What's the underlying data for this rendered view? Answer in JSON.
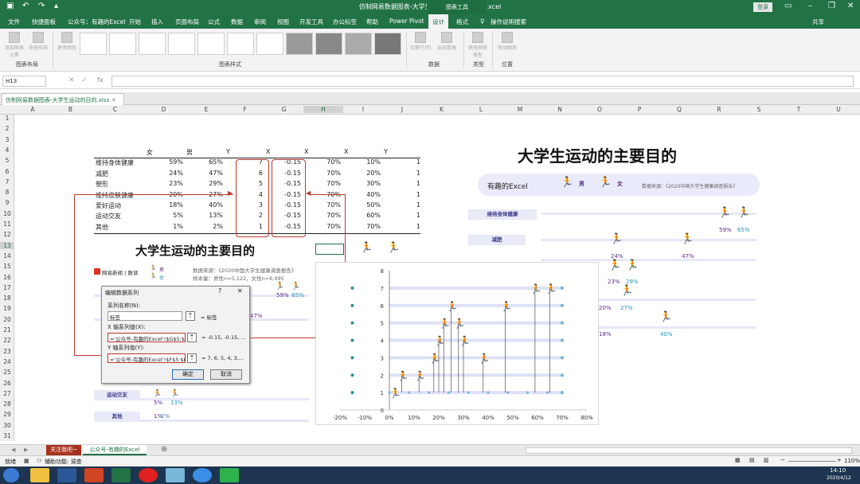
{
  "titlebar": {
    "title": "仿制网易数据图表-大学生运动的目的.xlsx  -  Excel",
    "chart_tools": "图表工具",
    "login": "登录"
  },
  "menu": [
    "文件",
    "快捷面板",
    "公众号：有趣的Excel",
    "开始",
    "插入",
    "页面布局",
    "公式",
    "数据",
    "审阅",
    "视图",
    "开发工具",
    "办公标签",
    "帮助",
    "Power Pivot",
    "设计",
    "格式",
    "操作说明搜索"
  ],
  "menu_selected": "设计",
  "share": "共享",
  "ribbon": {
    "groups": [
      "图表布局",
      "图表样式",
      "数据",
      "类型",
      "位置"
    ],
    "buttons": [
      "添加图表元素",
      "快速布局",
      "更改颜色",
      "切换行/列",
      "选择数据",
      "更改图表类型",
      "移动图表"
    ]
  },
  "formula_bar": {
    "name_box": "H13",
    "fx": "fx",
    "value": ""
  },
  "workbook_tab": "仿制网易数据图表-大学生运动的目的.xlsx",
  "columns": [
    "A",
    "B",
    "C",
    "D",
    "E",
    "F",
    "G",
    "H",
    "I",
    "J",
    "K",
    "L",
    "M",
    "N",
    "O",
    "P",
    "Q",
    "R",
    "S",
    "T",
    "U"
  ],
  "rows": [
    "1",
    "2",
    "3",
    "4",
    "5",
    "6",
    "7",
    "8",
    "9",
    "10",
    "11",
    "12",
    "13",
    "14",
    "15",
    "16",
    "17",
    "18",
    "19",
    "20",
    "21",
    "22",
    "23",
    "24",
    "25",
    "26",
    "27",
    "28",
    "29",
    "30",
    "31"
  ],
  "table": {
    "headers": [
      "女",
      "男",
      "Y",
      "X",
      "X",
      "X",
      "Y"
    ],
    "rows": [
      [
        "维持身体健康",
        "59%",
        "65%",
        "7",
        "-0.15",
        "70%",
        "10%",
        "1"
      ],
      [
        "减肥",
        "24%",
        "47%",
        "6",
        "-0.15",
        "70%",
        "20%",
        "1"
      ],
      [
        "塑形",
        "23%",
        "29%",
        "5",
        "-0.15",
        "70%",
        "30%",
        "1"
      ],
      [
        "维持皮肤健康",
        "20%",
        "27%",
        "4",
        "-0.15",
        "70%",
        "40%",
        "1"
      ],
      [
        "爱好运动",
        "18%",
        "40%",
        "3",
        "-0.15",
        "70%",
        "50%",
        "1"
      ],
      [
        "运动交友",
        "5%",
        "13%",
        "2",
        "-0.15",
        "70%",
        "60%",
        "1"
      ],
      [
        "其他",
        "1%",
        "2%",
        "1",
        "-0.15",
        "70%",
        "70%",
        "1"
      ]
    ]
  },
  "left_chart": {
    "title": "大学生运动的主要目的",
    "source": "网易新闻 | 数读",
    "note1": "数据来源：《2020中国大学生健康调查报告》",
    "note2": "样本量：男性n=5,122，女性n=6,995",
    "legend_m": "男",
    "legend_f": "女",
    "labels": [
      "运动交友",
      "其他"
    ],
    "pcts": [
      "59%",
      "65%",
      "47%",
      "5%",
      "13%",
      "1%",
      "2%"
    ]
  },
  "right_chart": {
    "title": "大学生运动的主要目的",
    "subtitle": "有趣的Excel",
    "legend_m": "男",
    "legend_f": "女",
    "source": "数据来源：《2020中国大学生健康调查报告》",
    "labels": [
      "维持身体健康",
      "减肥"
    ],
    "pcts": [
      "59%",
      "65%",
      "47%",
      "24%",
      "23%",
      "29%",
      "20%",
      "27%",
      "40%",
      "18%"
    ]
  },
  "dialog": {
    "title": "编辑数据系列",
    "name_label": "系列名称(N):",
    "name_value": "标签",
    "name_eq": "= 标签",
    "x_label": "X 轴系列值(X):",
    "x_value": "='公众号-有趣的Excel'!$G$5:$C",
    "x_eq": "= -0.15, -0.15, ...",
    "y_label": "Y 轴系列值(Y):",
    "y_value": "='公众号-有趣的Excel'!$F$5:$F!",
    "y_eq": "= 7, 6, 5, 4, 3,...",
    "ok": "确定",
    "cancel": "取消"
  },
  "chart_data": {
    "type": "scatter",
    "x_ticks": [
      "-20%",
      "-10%",
      "0%",
      "10%",
      "20%",
      "30%",
      "40%",
      "50%",
      "60%",
      "70%",
      "80%"
    ],
    "y_ticks": [
      "0",
      "1",
      "2",
      "3",
      "4",
      "5",
      "6",
      "7",
      "8"
    ],
    "xlim": [
      -0.2,
      0.8
    ],
    "ylim": [
      0,
      8
    ],
    "series": [
      {
        "x": [
          0.02,
          0.05,
          0.12,
          0.18,
          0.2,
          0.22,
          0.25,
          0.28,
          0.3,
          0.38,
          0.47,
          0.59,
          0.65
        ],
        "y": [
          1,
          2,
          2,
          3,
          4,
          5,
          6,
          5,
          4,
          3,
          6,
          7,
          7
        ]
      },
      {
        "x": [
          0.7,
          0.7,
          0.7,
          0.7,
          0.7,
          0.7,
          0.7
        ],
        "y": [
          1,
          2,
          3,
          4,
          5,
          6,
          7
        ]
      },
      {
        "x": [
          -0.15,
          -0.15,
          -0.15,
          -0.15,
          -0.15,
          -0.15,
          -0.15
        ],
        "y": [
          1,
          2,
          3,
          4,
          5,
          6,
          7
        ]
      }
    ]
  },
  "sheet_tabs": {
    "a": "关注我吧~",
    "b": "公众号-有趣的Excel"
  },
  "status": {
    "ready": "就绪",
    "accessibility": "辅助功能: 调查",
    "zoom": "110%"
  },
  "clock": {
    "time": "14:10",
    "date": "2020/4/12"
  },
  "colors": {
    "excel_green": "#217346",
    "male": "#5b2a86",
    "female": "#2a8fb4",
    "runner": "#c65a1e",
    "red": "#c0392b"
  }
}
